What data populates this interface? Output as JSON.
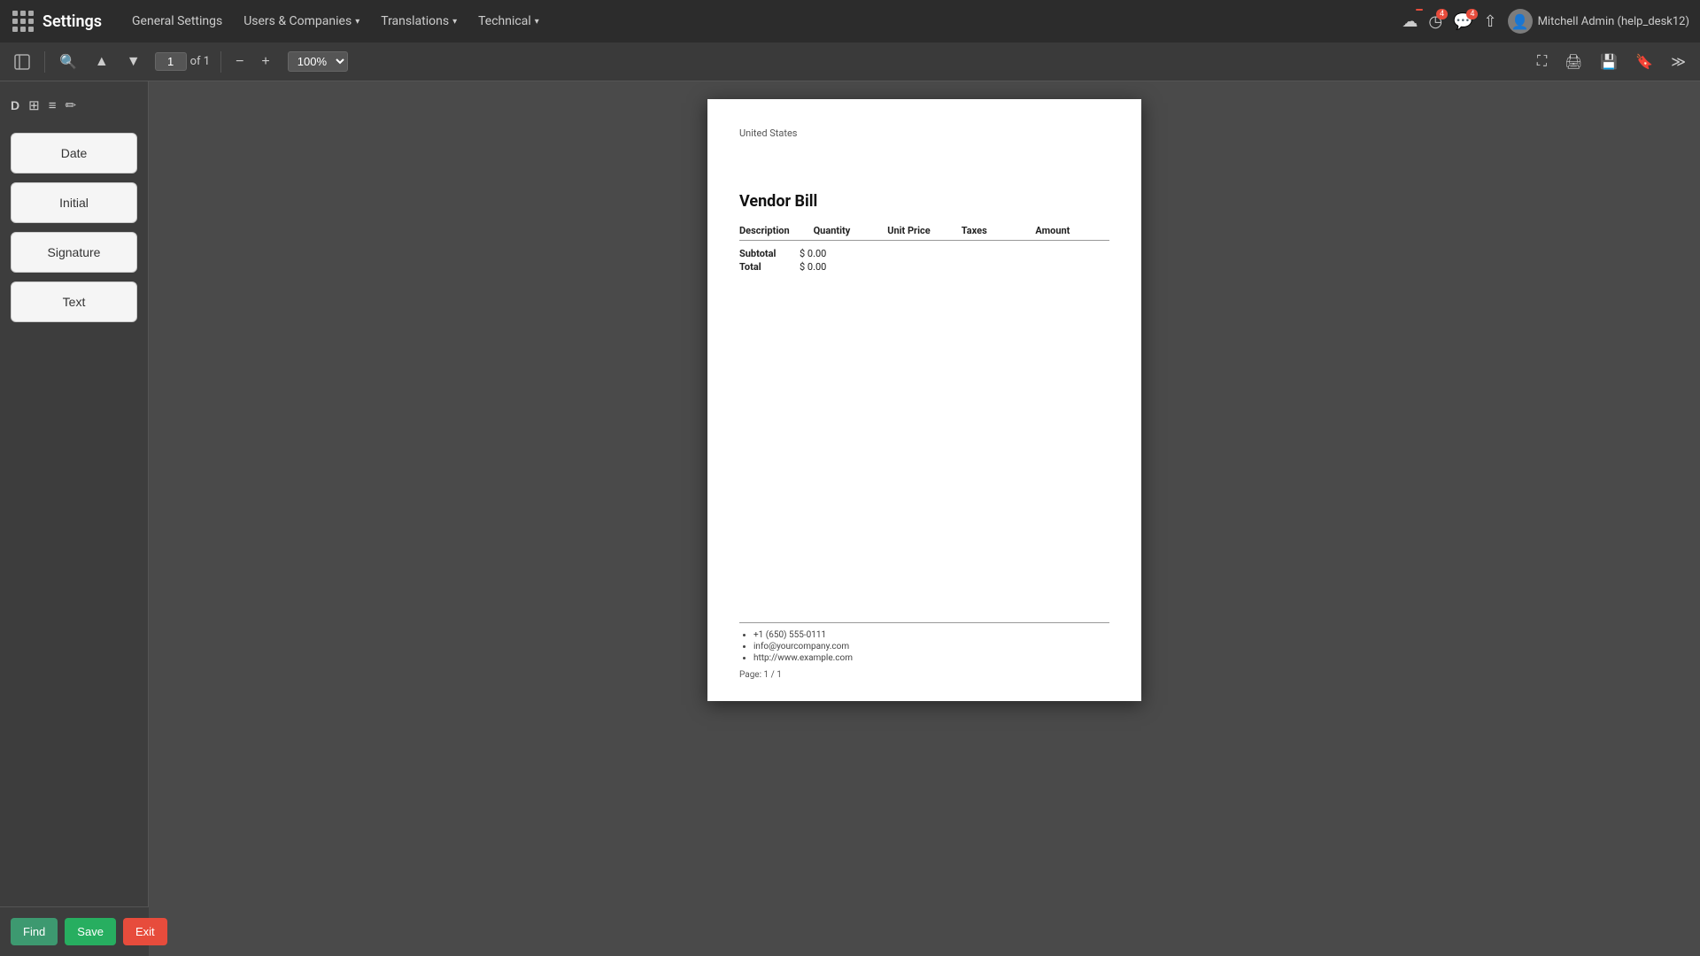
{
  "app": {
    "title": "Settings"
  },
  "topnav": {
    "title": "Settings",
    "items": [
      {
        "id": "general",
        "label": "General Settings",
        "has_dropdown": false
      },
      {
        "id": "users",
        "label": "Users & Companies",
        "has_dropdown": true
      },
      {
        "id": "translations",
        "label": "Translations",
        "has_dropdown": true
      },
      {
        "id": "technical",
        "label": "Technical",
        "has_dropdown": true
      }
    ],
    "user": "Mitchell Admin (help_desk12)",
    "notification_count": "4",
    "message_count": "4"
  },
  "toolbar": {
    "page_current": "1",
    "page_total": "of 1",
    "zoom_level": "100%"
  },
  "sidebar": {
    "fields": [
      {
        "id": "date",
        "label": "Date"
      },
      {
        "id": "initial",
        "label": "Initial"
      },
      {
        "id": "signature",
        "label": "Signature"
      },
      {
        "id": "text",
        "label": "Text"
      }
    ]
  },
  "bottom_bar": {
    "find_label": "Find",
    "save_label": "Save",
    "exit_label": "Exit"
  },
  "pdf": {
    "location": "United States",
    "title": "Vendor Bill",
    "table_headers": [
      "Description",
      "Quantity",
      "Unit Price",
      "Taxes",
      "Amount"
    ],
    "subtotal_label": "Subtotal",
    "subtotal_value": "$ 0.00",
    "total_label": "Total",
    "total_value": "$ 0.00",
    "footer": {
      "phone": "+1 (650) 555-0111",
      "email": "info@yourcompany.com",
      "website": "http://www.example.com"
    },
    "page_label": "Page: 1 / 1"
  }
}
